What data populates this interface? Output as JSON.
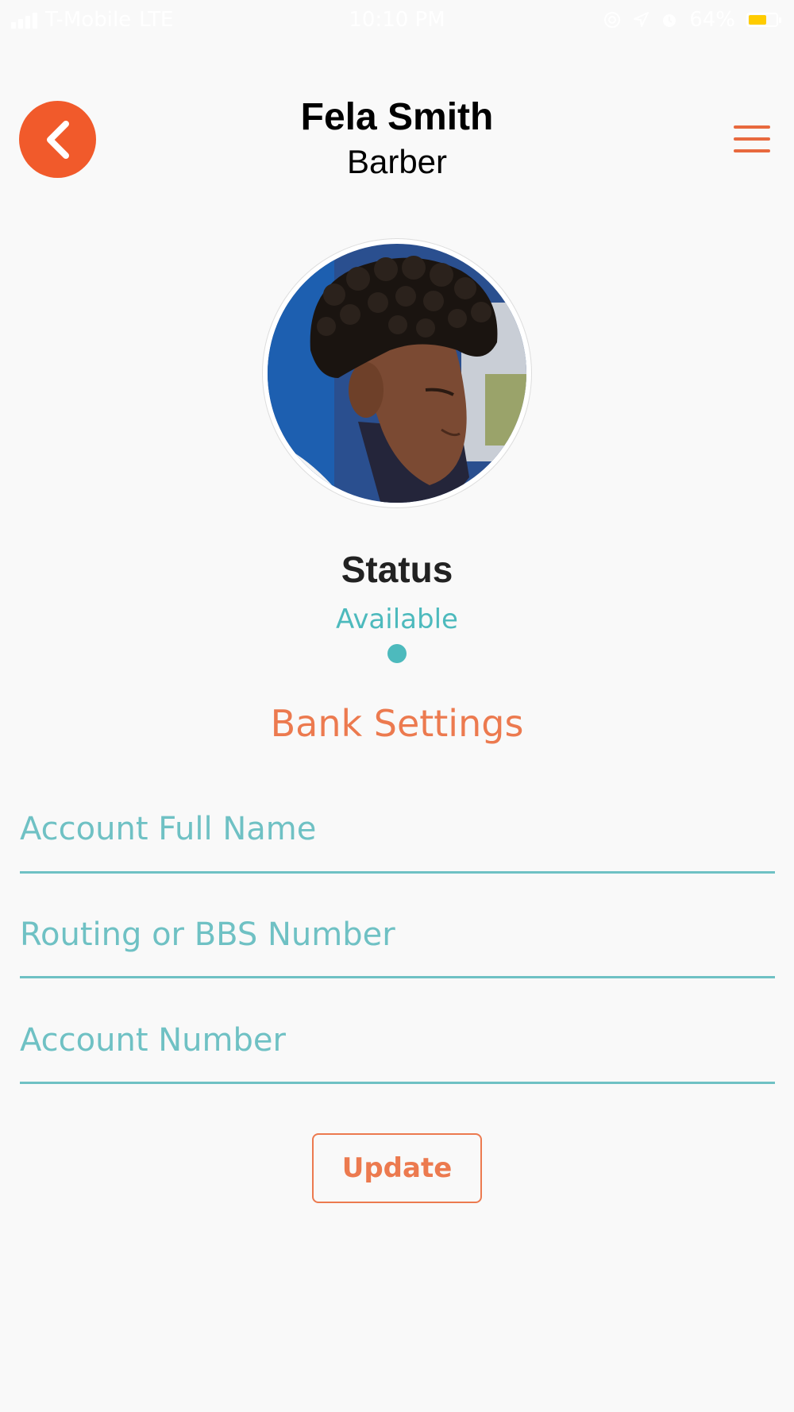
{
  "status_bar": {
    "carrier": "T-Mobile",
    "network": "LTE",
    "time": "10:10 PM",
    "battery_percent": "64%",
    "battery_level": 0.64,
    "battery_color": "#ffcc00",
    "icons": [
      "signal-icon",
      "at-icon",
      "location-arrow-icon",
      "alarm-icon",
      "battery-icon"
    ]
  },
  "header": {
    "name": "Fela Smith",
    "role": "Barber",
    "back_icon": "chevron-left-icon",
    "menu_icon": "hamburger-menu-icon"
  },
  "profile": {
    "status_label": "Status",
    "status_value": "Available"
  },
  "bank_settings": {
    "title": "Bank Settings",
    "fields": [
      {
        "placeholder": "Account Full Name",
        "value": ""
      },
      {
        "placeholder": "Routing or BBS Number",
        "value": ""
      },
      {
        "placeholder": "Account Number",
        "value": ""
      }
    ],
    "update_label": "Update"
  },
  "colors": {
    "accent_orange": "#f15a2b",
    "section_orange": "#ec7a4f",
    "teal": "#4dbabd",
    "field_line": "#6fc1c4",
    "background": "#f9f9f9"
  }
}
